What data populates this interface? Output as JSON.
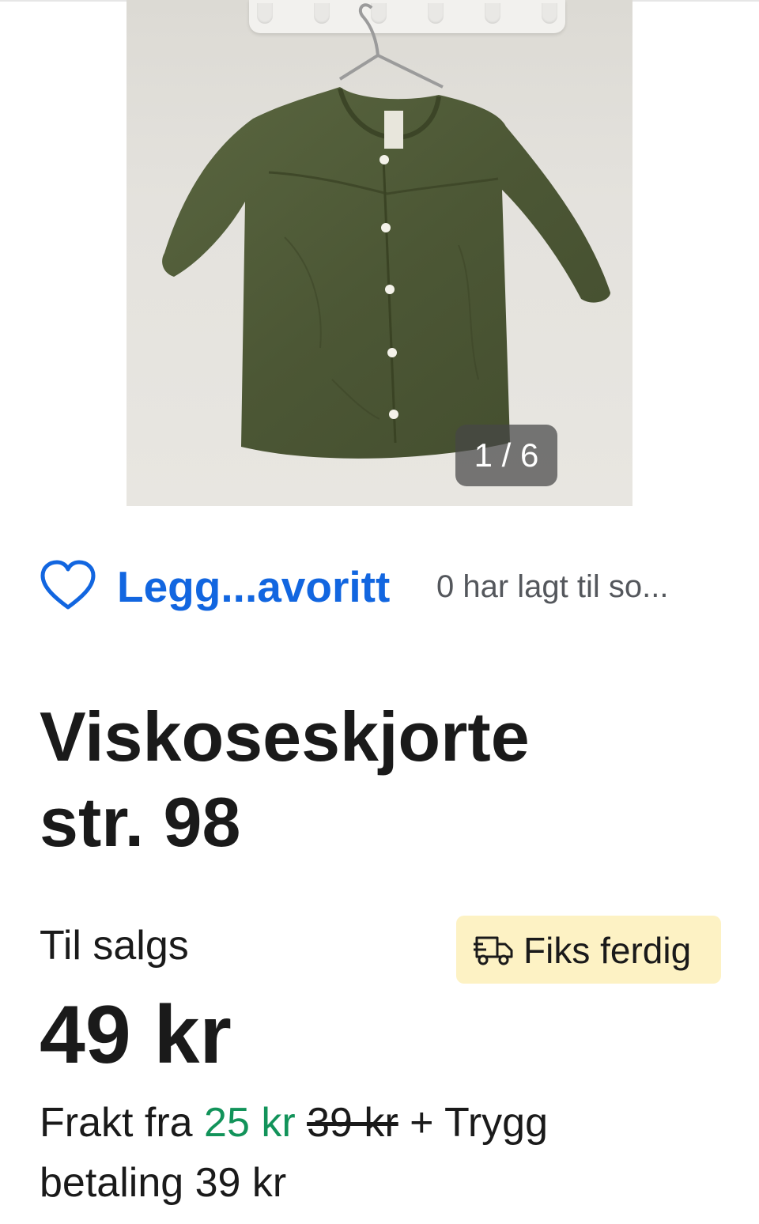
{
  "gallery": {
    "image_alt": "Viskoseskjorte str. 98",
    "counter": "1 / 6",
    "current_index": 1,
    "total_images": 6
  },
  "favorite": {
    "button_label": "Legg...avoritt",
    "count_text": "0 har lagt til so...",
    "icon": "heart-outline-icon",
    "accent_color": "#1266e0"
  },
  "listing": {
    "title_line1": "Viskoseskjorte",
    "title_line2": "str. 98",
    "status": "Til salgs",
    "price": "49 kr",
    "badge": {
      "icon": "delivery-truck-icon",
      "label": "Fiks ferdig",
      "background": "#fdf2c4"
    },
    "shipping": {
      "prefix": "Frakt fra",
      "discounted_price": "25 kr",
      "original_price": "39 kr",
      "connector": "+ Trygg",
      "line2": "betaling 39 kr",
      "discount_color": "#12935a"
    }
  }
}
